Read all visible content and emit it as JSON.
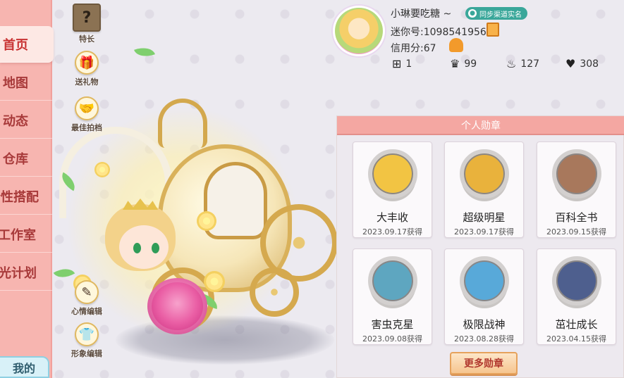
{
  "nav": {
    "items": [
      {
        "label": "首页",
        "active": true
      },
      {
        "label": "地图"
      },
      {
        "label": "动态"
      },
      {
        "label": "仓库"
      },
      {
        "label": "个性搭配"
      },
      {
        "label": "工作室"
      },
      {
        "label": "阳光计划"
      }
    ],
    "mine_label": "我的"
  },
  "scene": {
    "buttons": {
      "special": {
        "icon": "?",
        "label": "特长"
      },
      "gift": {
        "icon": "gift-icon",
        "label": "送礼物"
      },
      "partner": {
        "icon": "handshake-icon",
        "label": "最佳拍档"
      },
      "mood": {
        "icon": "edit-icon",
        "label": "心情编辑"
      },
      "appearance": {
        "icon": "outfit-icon",
        "label": "形象编辑"
      }
    }
  },
  "profile": {
    "username": "小琳要吃糖 ~",
    "realname_badge": "同步渠道实名",
    "uid_text": "迷你号:1098541956",
    "credit_text": "信用分:67",
    "stats": {
      "add": "1",
      "likes": "99",
      "fire": "127",
      "hearts": "308"
    }
  },
  "medals": {
    "title": "个人勋章",
    "items": [
      {
        "name": "大丰收",
        "date": "2023.09.17获得",
        "color": "#f2c443"
      },
      {
        "name": "超级明星",
        "date": "2023.09.17获得",
        "color": "#e9b23c"
      },
      {
        "name": "百科全书",
        "date": "2023.09.15获得",
        "color": "#a8785c"
      },
      {
        "name": "害虫克星",
        "date": "2023.09.08获得",
        "color": "#5ea6c0"
      },
      {
        "name": "极限战神",
        "date": "2023.08.28获得",
        "color": "#58a9d9"
      },
      {
        "name": "茁壮成长",
        "date": "2023.04.15获得",
        "color": "#4e5f8e"
      }
    ],
    "more_label": "更多勋章"
  }
}
